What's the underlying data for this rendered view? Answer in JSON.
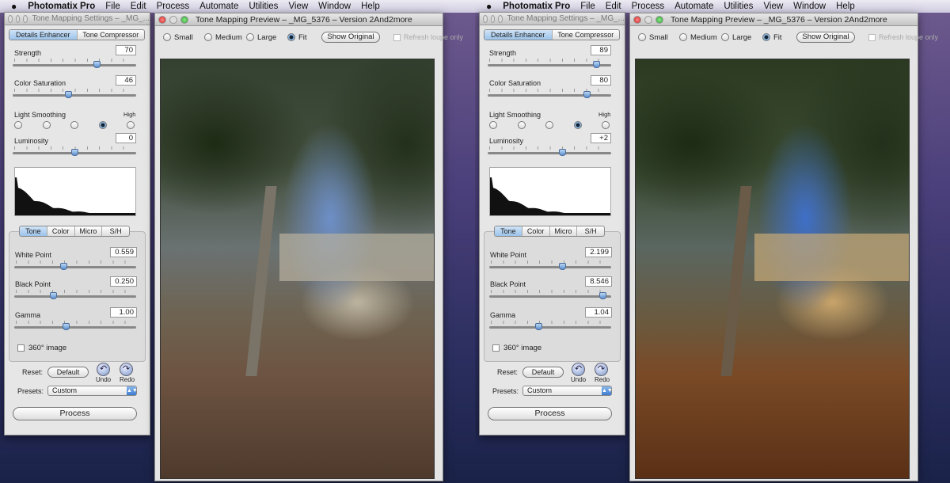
{
  "menubar": {
    "apple_icon": "apple-logo",
    "app": "Photomatix Pro",
    "items": [
      "File",
      "Edit",
      "Process",
      "Automate",
      "Utilities",
      "View",
      "Window",
      "Help"
    ]
  },
  "panels": [
    {
      "settings": {
        "title": "Tone Mapping Settings – _MG_...",
        "method_tabs": [
          "Details Enhancer",
          "Tone Compressor"
        ],
        "active_method": 0,
        "strength": {
          "label": "Strength",
          "value": "70",
          "level": 0.68
        },
        "saturation": {
          "label": "Color Saturation",
          "value": "46",
          "level": 0.45
        },
        "smoothing": {
          "label": "Light Smoothing",
          "high_label": "High",
          "selected": 3,
          "count": 5
        },
        "luminosity": {
          "label": "Luminosity",
          "value": "0",
          "level": 0.5
        },
        "sub_tabs": [
          "Tone",
          "Color",
          "Micro",
          "S/H"
        ],
        "active_sub": 0,
        "white_point": {
          "label": "White Point",
          "value": "0.559",
          "level": 0.4
        },
        "black_point": {
          "label": "Black Point",
          "value": "0.250",
          "level": 0.32
        },
        "gamma": {
          "label": "Gamma",
          "value": "1.00",
          "level": 0.42
        },
        "image360": {
          "label": "360° image",
          "checked": false
        },
        "reset_label": "Reset:",
        "default_button": "Default",
        "undo": "Undo",
        "redo": "Redo",
        "presets_label": "Presets:",
        "preset_value": "Custom",
        "process_button": "Process"
      },
      "preview": {
        "title": "Tone Mapping Preview – _MG_5376 – Version 2And2more",
        "sizes": [
          "Small",
          "Medium",
          "Large",
          "Fit"
        ],
        "selected_size": 3,
        "show_original": "Show Original",
        "refresh_loupe": "Refresh loupe only"
      }
    },
    {
      "settings": {
        "title": "Tone Mapping Settings – _MG_...",
        "method_tabs": [
          "Details Enhancer",
          "Tone Compressor"
        ],
        "active_method": 0,
        "strength": {
          "label": "Strength",
          "value": "89",
          "level": 0.88
        },
        "saturation": {
          "label": "Color Saturation",
          "value": "80",
          "level": 0.8
        },
        "smoothing": {
          "label": "Light Smoothing",
          "high_label": "High",
          "selected": 3,
          "count": 5
        },
        "luminosity": {
          "label": "Luminosity",
          "value": "+2",
          "level": 0.6
        },
        "sub_tabs": [
          "Tone",
          "Color",
          "Micro",
          "S/H"
        ],
        "active_sub": 0,
        "white_point": {
          "label": "White Point",
          "value": "2.199",
          "level": 0.6
        },
        "black_point": {
          "label": "Black Point",
          "value": "8.546",
          "level": 0.93
        },
        "gamma": {
          "label": "Gamma",
          "value": "1.04",
          "level": 0.4
        },
        "image360": {
          "label": "360° image",
          "checked": false
        },
        "reset_label": "Reset:",
        "default_button": "Default",
        "undo": "Undo",
        "redo": "Redo",
        "presets_label": "Presets:",
        "preset_value": "Custom",
        "process_button": "Process"
      },
      "preview": {
        "title": "Tone Mapping Preview – _MG_5376 – Version 2And2more",
        "sizes": [
          "Small",
          "Medium",
          "Large",
          "Fit"
        ],
        "selected_size": 3,
        "show_original": "Show Original",
        "refresh_loupe": "Refresh loupe only"
      }
    }
  ]
}
